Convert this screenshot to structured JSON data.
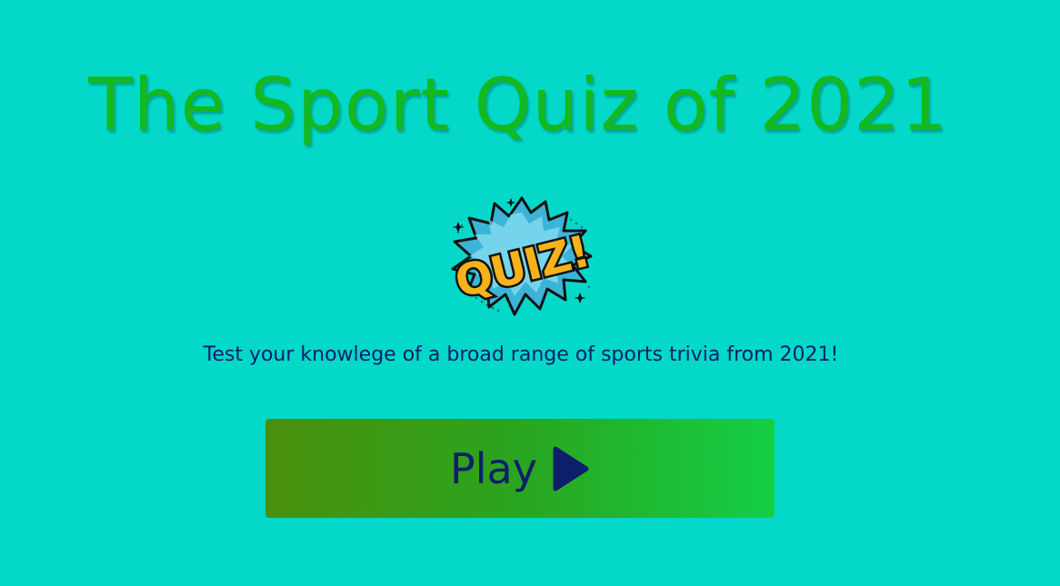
{
  "header": {
    "title": "The Sport Quiz of 2021"
  },
  "logo": {
    "text": "QUIZ!",
    "icon": "quiz-burst-logo"
  },
  "intro": {
    "text": "Test your knowlege of a broad range of sports trivia from 2021!"
  },
  "play_button": {
    "label": "Play",
    "icon": "play-triangle-icon"
  },
  "colors": {
    "background": "#04d8c9",
    "title": "#14b81f",
    "text": "#0d1f6b",
    "button_start": "#4a8f0c",
    "button_end": "#14cf45",
    "logo_yellow": "#f6b21a",
    "logo_blue": "#3bb4d8"
  }
}
